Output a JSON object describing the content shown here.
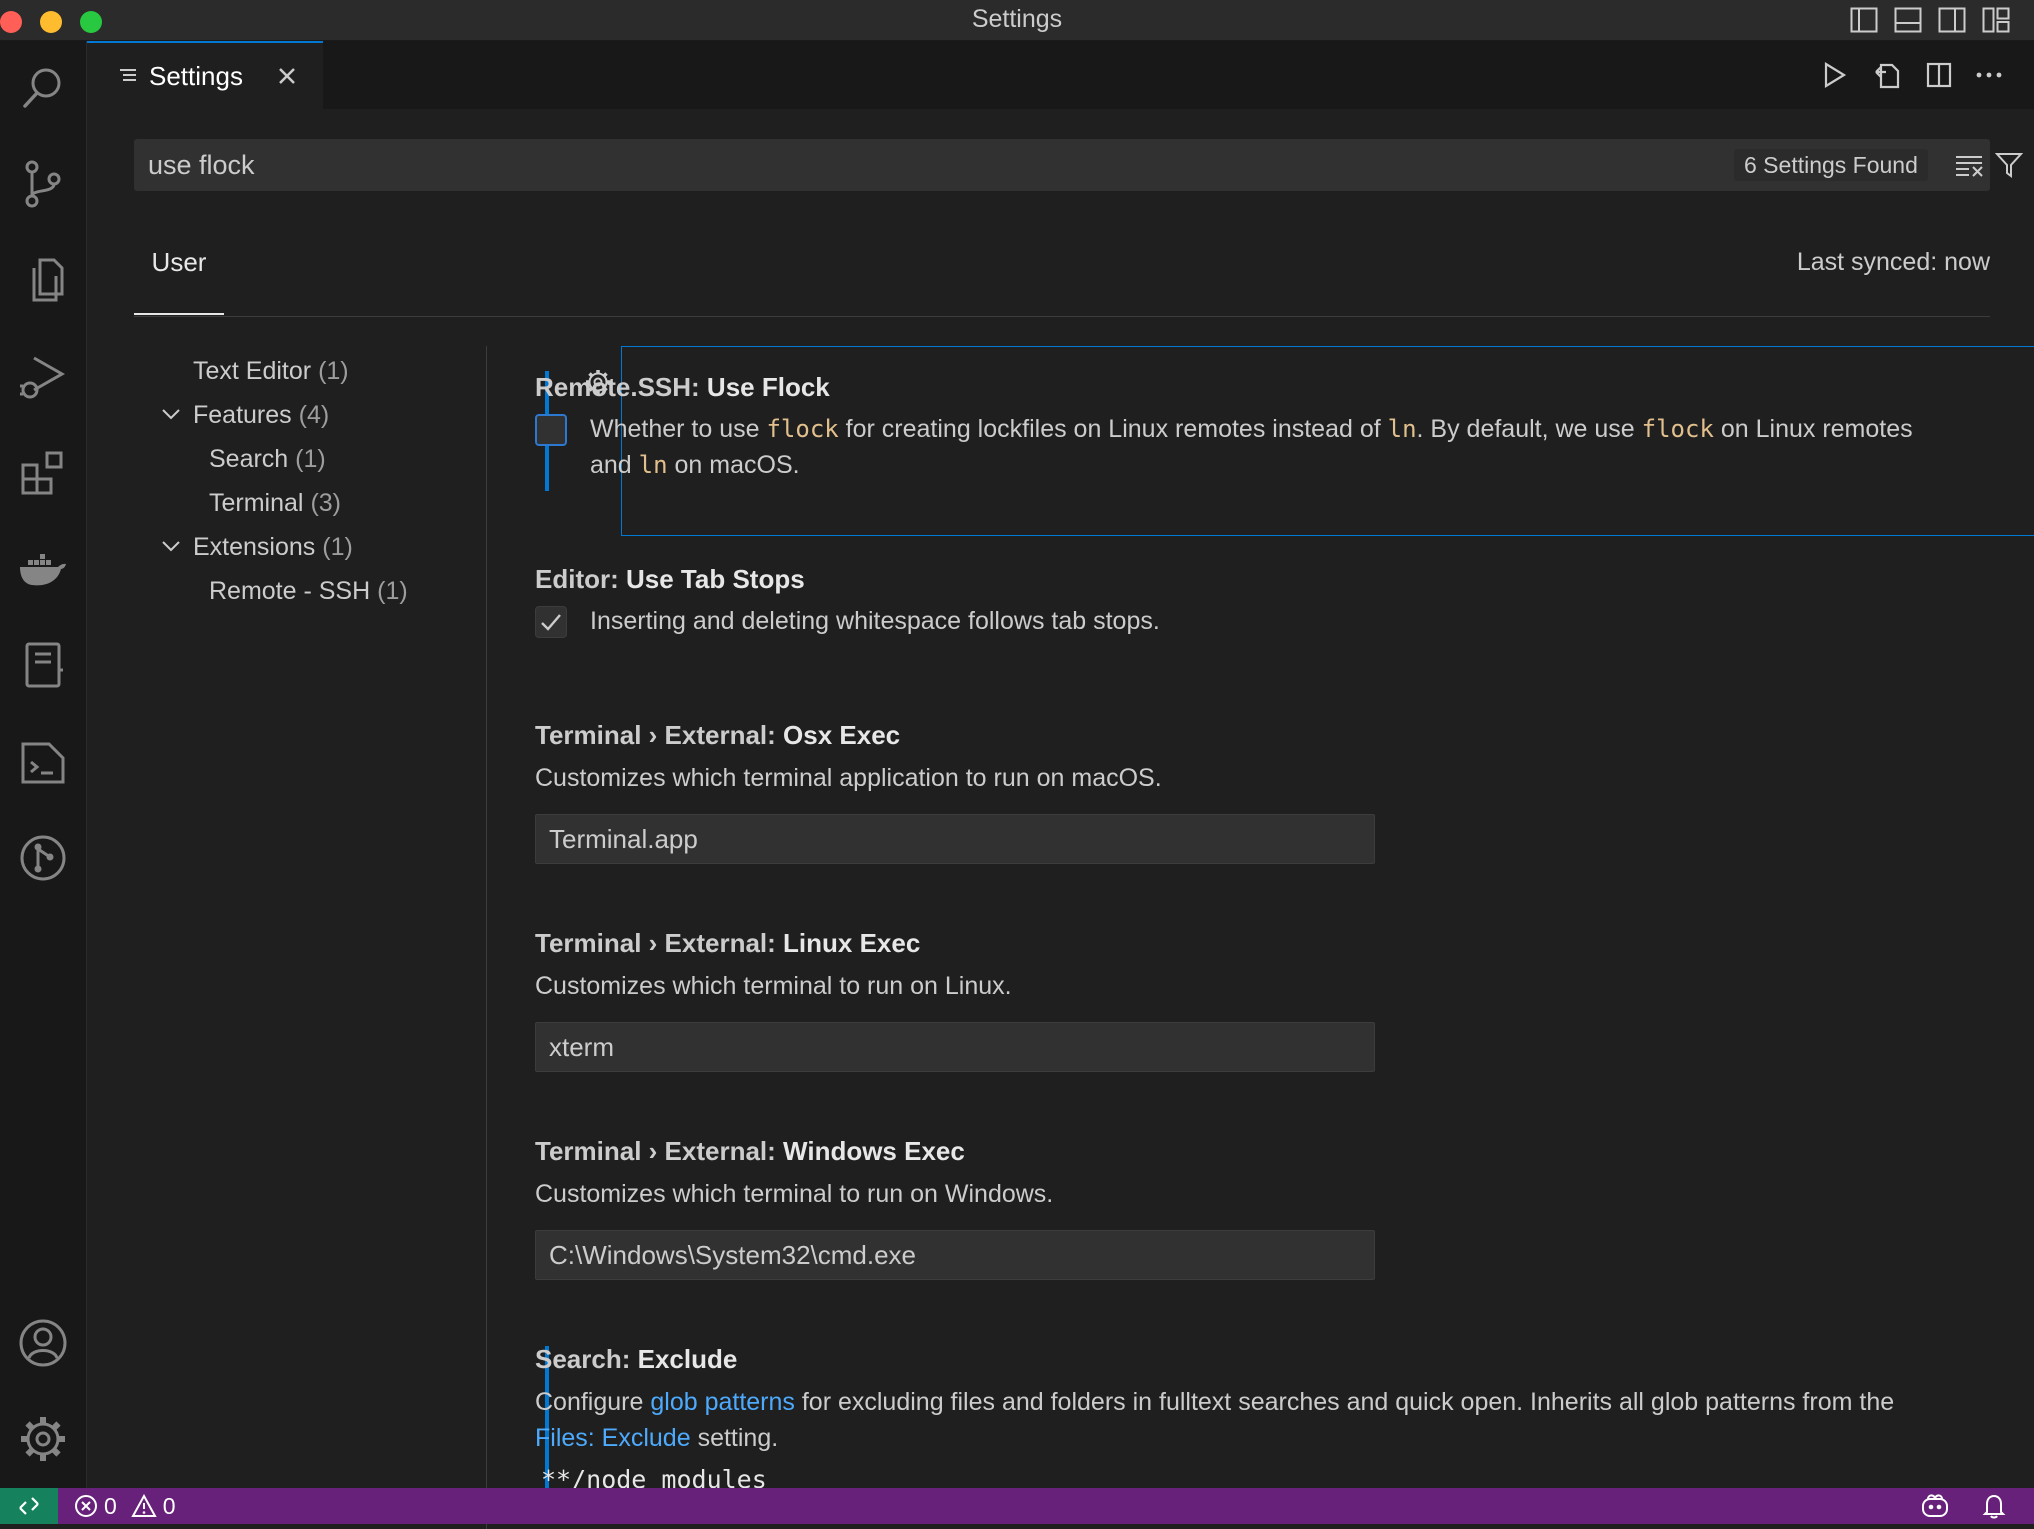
{
  "window": {
    "title": "Settings"
  },
  "activity_bar": {
    "items": [
      {
        "name": "search-icon"
      },
      {
        "name": "source-control-icon"
      },
      {
        "name": "explorer-icon"
      },
      {
        "name": "run-debug-icon"
      },
      {
        "name": "extensions-icon"
      },
      {
        "name": "docker-icon"
      },
      {
        "name": "notebook-icon"
      },
      {
        "name": "terminal-icon"
      },
      {
        "name": "git-graph-icon"
      }
    ],
    "bottom": [
      {
        "name": "account-icon"
      },
      {
        "name": "manage-gear-icon"
      }
    ]
  },
  "tab": {
    "label": "Settings"
  },
  "search": {
    "value": "use flock",
    "results": "6 Settings Found"
  },
  "scope": {
    "user_tab": "User",
    "last_synced": "Last synced: now"
  },
  "toc": [
    {
      "label": "Text Editor",
      "count": "(1)"
    },
    {
      "label": "Features",
      "count": "(4)"
    },
    {
      "label": "Search",
      "count": "(1)"
    },
    {
      "label": "Terminal",
      "count": "(3)"
    },
    {
      "label": "Extensions",
      "count": "(1)"
    },
    {
      "label": "Remote - SSH",
      "count": "(1)"
    }
  ],
  "settings": {
    "flock": {
      "category": "Remote.SSH: ",
      "key": "Use Flock",
      "checked": false,
      "desc": {
        "p1": "Whether to use ",
        "c1": "flock",
        "p2": " for creating lockfiles on Linux remotes instead of ",
        "c2": "ln",
        "p3": ". By default, we use ",
        "c3": "flock",
        "p4": " on Linux remotes and ",
        "c4": "ln",
        "p5": " on macOS."
      }
    },
    "tabstops": {
      "category": "Editor: ",
      "key": "Use Tab Stops",
      "checked": true,
      "desc": "Inserting and deleting whitespace follows tab stops."
    },
    "osx": {
      "category": "Terminal › External: ",
      "key": "Osx Exec",
      "desc": "Customizes which terminal application to run on macOS.",
      "value": "Terminal.app"
    },
    "linux": {
      "category": "Terminal › External: ",
      "key": "Linux Exec",
      "desc": "Customizes which terminal to run on Linux.",
      "value": "xterm"
    },
    "windows": {
      "category": "Terminal › External: ",
      "key": "Windows Exec",
      "desc": "Customizes which terminal to run on Windows.",
      "value": "C:\\Windows\\System32\\cmd.exe"
    },
    "exclude": {
      "category": "Search: ",
      "key": "Exclude",
      "desc_a": "Configure ",
      "link1": "glob patterns",
      "desc_b": " for excluding files and folders in fulltext searches and quick open. Inherits all glob patterns from the ",
      "link2": "Files: Exclude",
      "desc_c": " setting.",
      "first_pattern": "**/node_modules"
    }
  },
  "statusbar": {
    "errors": "0",
    "warnings": "0"
  },
  "colors": {
    "accent": "#0078d4",
    "statusbar": "#68217a",
    "remote": "#16825d",
    "code": "#e2c08d",
    "link": "#4daafc"
  }
}
